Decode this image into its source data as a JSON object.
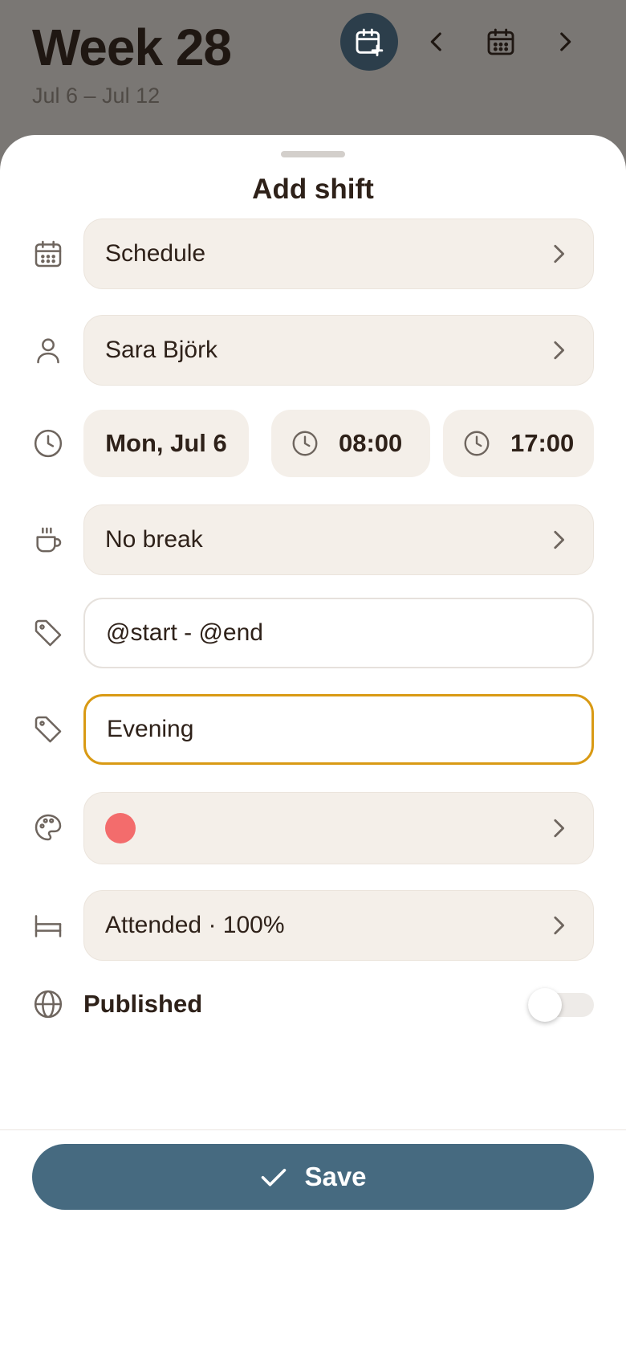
{
  "header": {
    "title": "Week 28",
    "range": "Jul 6 – Jul 12",
    "icons": [
      "calendar-plus-icon",
      "chevron-left-icon",
      "calendar-icon",
      "chevron-right-icon"
    ]
  },
  "sheet": {
    "title": "Add shift",
    "schedule": {
      "value": "Schedule",
      "icon": "calendar-icon"
    },
    "employee": {
      "value": "Sara Björk",
      "icon": "person-icon"
    },
    "date": {
      "value": "Mon, Jul 6",
      "icon": "clock-icon"
    },
    "start_time": "08:00",
    "end_time": "17:00",
    "break": {
      "value": "No break",
      "icon": "coffee-cup-icon"
    },
    "title_template": {
      "value": "@start - @end",
      "icon": "tag-icon"
    },
    "label": {
      "value": "Evening",
      "icon": "tag-icon"
    },
    "color": {
      "value": "#f36c6c",
      "icon": "palette-icon"
    },
    "attendance": {
      "value": "Attended · 100%",
      "icon": "bed-icon"
    },
    "published": {
      "label": "Published",
      "enabled": false,
      "icon": "globe-icon"
    }
  },
  "footer": {
    "save_label": "Save"
  },
  "colors": {
    "accent": "#466a80",
    "focus": "#d99a14",
    "header_button": "#2c3e4b",
    "field_bg": "#f4efe9"
  }
}
